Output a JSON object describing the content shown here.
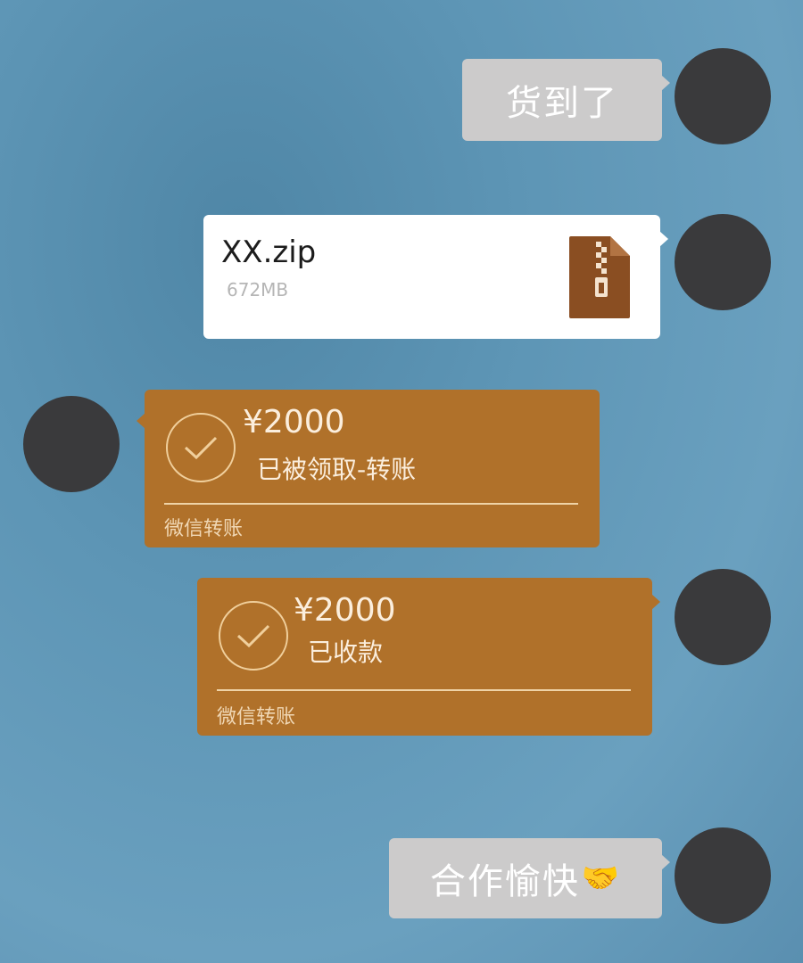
{
  "messages": {
    "msg1": {
      "text": "货到了"
    },
    "file": {
      "name": "XX.zip",
      "size": "672MB",
      "icon": "zip-file-icon"
    },
    "transfer_received": {
      "amount": "¥2000",
      "status": "已被领取-转账",
      "footer": "微信转账",
      "icon": "check-icon"
    },
    "transfer_collected": {
      "amount": "¥2000",
      "status": "已收款",
      "footer": "微信转账",
      "icon": "check-icon"
    },
    "msg_last": {
      "text": "合作愉快",
      "emoji": "🤝"
    }
  },
  "colors": {
    "background": "#5d95b5",
    "text_bubble": "#cccbcb",
    "file_bubble": "#ffffff",
    "pay_bubble": "#b0712a",
    "avatar": "#3a3a3c",
    "zip_icon": "#8a4e22"
  }
}
